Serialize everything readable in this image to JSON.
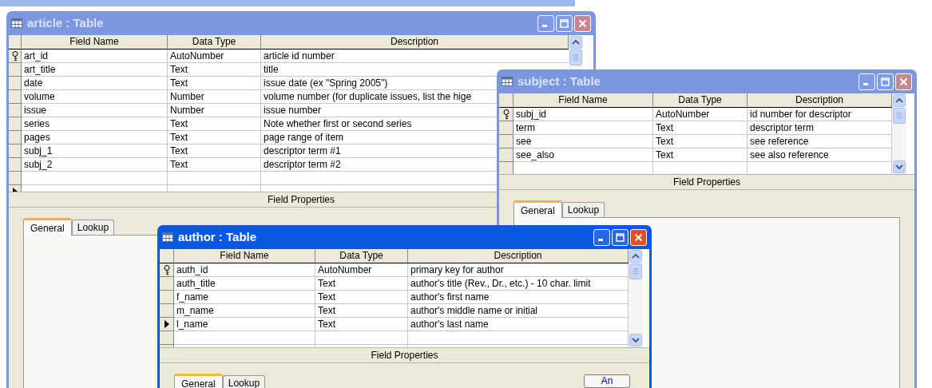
{
  "windows": [
    {
      "title": "article : Table",
      "active": false,
      "columns": [
        "Field Name",
        "Data Type",
        "Description"
      ],
      "rows": [
        {
          "field": "art_id",
          "type": "AutoNumber",
          "description": "article id number",
          "primary_key": true,
          "current": false
        },
        {
          "field": "art_title",
          "type": "Text",
          "description": "title",
          "primary_key": false,
          "current": false
        },
        {
          "field": "date",
          "type": "Text",
          "description": "issue date (ex \"Spring 2005\")",
          "primary_key": false,
          "current": false
        },
        {
          "field": "volume",
          "type": "Number",
          "description": "volume number (for duplicate issues, list the hige",
          "primary_key": false,
          "current": false
        },
        {
          "field": "issue",
          "type": "Number",
          "description": "issue number",
          "primary_key": false,
          "current": false
        },
        {
          "field": "series",
          "type": "Text",
          "description": "Note whether first or second series",
          "primary_key": false,
          "current": false
        },
        {
          "field": "pages",
          "type": "Text",
          "description": "page range of item",
          "primary_key": false,
          "current": false
        },
        {
          "field": "subj_1",
          "type": "Text",
          "description": "descriptor term #1",
          "primary_key": false,
          "current": false
        },
        {
          "field": "subj_2",
          "type": "Text",
          "description": "descriptor term #2",
          "primary_key": false,
          "current": false
        }
      ],
      "new_row_current": true,
      "properties_label": "Field Properties",
      "tabs": [
        {
          "label": "General",
          "selected": true
        },
        {
          "label": "Lookup",
          "selected": false
        }
      ]
    },
    {
      "title": "subject : Table",
      "active": false,
      "columns": [
        "Field Name",
        "Data Type",
        "Description"
      ],
      "rows": [
        {
          "field": "subj_id",
          "type": "AutoNumber",
          "description": "id number for descriptor",
          "primary_key": true,
          "current": false
        },
        {
          "field": "term",
          "type": "Text",
          "description": "descriptor term",
          "primary_key": false,
          "current": false
        },
        {
          "field": "see",
          "type": "Text",
          "description": "see reference",
          "primary_key": false,
          "current": false
        },
        {
          "field": "see_also",
          "type": "Text",
          "description": "see also reference",
          "primary_key": false,
          "current": false
        }
      ],
      "new_row_current": false,
      "properties_label": "Field Properties",
      "tabs": [
        {
          "label": "General",
          "selected": true
        },
        {
          "label": "Lookup",
          "selected": false
        }
      ]
    },
    {
      "title": "author : Table",
      "active": true,
      "columns": [
        "Field Name",
        "Data Type",
        "Description"
      ],
      "rows": [
        {
          "field": "auth_id",
          "type": "AutoNumber",
          "description": "primary key for author",
          "primary_key": true,
          "current": false
        },
        {
          "field": "auth_title",
          "type": "Text",
          "description": "author's title (Rev., Dr., etc.) - 10 char. limit",
          "primary_key": false,
          "current": false
        },
        {
          "field": "f_name",
          "type": "Text",
          "description": "author's first name",
          "primary_key": false,
          "current": false
        },
        {
          "field": "m_name",
          "type": "Text",
          "description": "author's middle name or initial",
          "primary_key": false,
          "current": false
        },
        {
          "field": "l_name",
          "type": "Text",
          "description": "author's last name",
          "primary_key": false,
          "current": true
        }
      ],
      "new_row_current": false,
      "properties_label": "Field Properties",
      "tabs": [
        {
          "label": "General",
          "selected": true
        },
        {
          "label": "Lookup",
          "selected": false
        }
      ],
      "side_button": "An"
    }
  ]
}
